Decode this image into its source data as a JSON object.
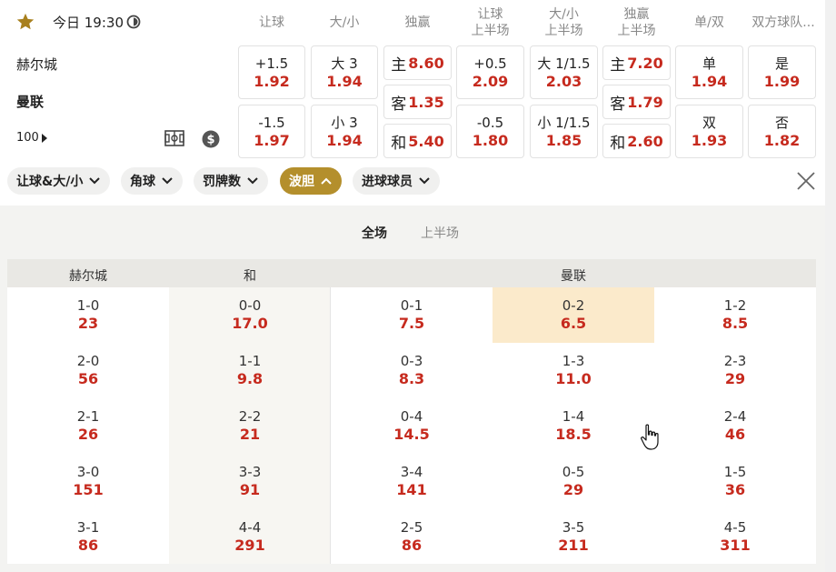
{
  "match": {
    "time": "今日 19:30",
    "home": "赫尔城",
    "away": "曼联",
    "more_markets": "100"
  },
  "columns": [
    {
      "line1": "让球",
      "line2": ""
    },
    {
      "line1": "大/小",
      "line2": ""
    },
    {
      "line1": "独赢",
      "line2": ""
    },
    {
      "line1": "让球",
      "line2": "上半场"
    },
    {
      "line1": "大/小",
      "line2": "上半场"
    },
    {
      "line1": "独赢",
      "line2": "上半场"
    },
    {
      "line1": "单/双",
      "line2": ""
    },
    {
      "line1": "双方球队...",
      "line2": ""
    }
  ],
  "odds": {
    "handicap": [
      {
        "label": "+1.5",
        "value": "1.92"
      },
      {
        "label": "-1.5",
        "value": "1.97"
      }
    ],
    "over_under": [
      {
        "label": "大 3",
        "value": "1.94"
      },
      {
        "label": "小 3",
        "value": "1.94"
      }
    ],
    "moneyline": [
      {
        "label": "主",
        "value": "8.60"
      },
      {
        "label": "客",
        "value": "1.35"
      },
      {
        "label": "和",
        "value": "5.40"
      }
    ],
    "handicap_1h": [
      {
        "label": "+0.5",
        "value": "2.09"
      },
      {
        "label": "-0.5",
        "value": "1.80"
      }
    ],
    "over_under_1h": [
      {
        "label": "大 1/1.5",
        "value": "2.03"
      },
      {
        "label": "小 1/1.5",
        "value": "1.85"
      }
    ],
    "moneyline_1h": [
      {
        "label": "主",
        "value": "7.20"
      },
      {
        "label": "客",
        "value": "1.79"
      },
      {
        "label": "和",
        "value": "2.60"
      }
    ],
    "odd_even": [
      {
        "label": "单",
        "value": "1.94"
      },
      {
        "label": "双",
        "value": "1.93"
      }
    ],
    "btts": [
      {
        "label": "是",
        "value": "1.99"
      },
      {
        "label": "否",
        "value": "1.82"
      }
    ]
  },
  "filters": [
    {
      "label": "让球&大/小",
      "active": false
    },
    {
      "label": "角球",
      "active": false
    },
    {
      "label": "罚牌数",
      "active": false
    },
    {
      "label": "波胆",
      "active": true
    },
    {
      "label": "进球球员",
      "active": false
    }
  ],
  "tabs": [
    {
      "label": "全场",
      "active": true
    },
    {
      "label": "上半场",
      "active": false
    }
  ],
  "correct_score": {
    "headers": {
      "home": "赫尔城",
      "draw": "和",
      "away": "曼联"
    },
    "columns": [
      [
        {
          "score": "1-0",
          "price": "23"
        },
        {
          "score": "2-0",
          "price": "56"
        },
        {
          "score": "2-1",
          "price": "26"
        },
        {
          "score": "3-0",
          "price": "151"
        },
        {
          "score": "3-1",
          "price": "86"
        }
      ],
      [
        {
          "score": "0-0",
          "price": "17.0"
        },
        {
          "score": "1-1",
          "price": "9.8"
        },
        {
          "score": "2-2",
          "price": "21"
        },
        {
          "score": "3-3",
          "price": "91"
        },
        {
          "score": "4-4",
          "price": "291"
        }
      ],
      [
        {
          "score": "0-1",
          "price": "7.5"
        },
        {
          "score": "0-3",
          "price": "8.3"
        },
        {
          "score": "0-4",
          "price": "14.5"
        },
        {
          "score": "3-4",
          "price": "141"
        },
        {
          "score": "2-5",
          "price": "86"
        }
      ],
      [
        {
          "score": "0-2",
          "price": "6.5"
        },
        {
          "score": "1-3",
          "price": "11.0"
        },
        {
          "score": "1-4",
          "price": "18.5"
        },
        {
          "score": "0-5",
          "price": "29"
        },
        {
          "score": "3-5",
          "price": "211"
        }
      ],
      [
        {
          "score": "1-2",
          "price": "8.5"
        },
        {
          "score": "2-3",
          "price": "29"
        },
        {
          "score": "2-4",
          "price": "46"
        },
        {
          "score": "1-5",
          "price": "36"
        },
        {
          "score": "4-5",
          "price": "311"
        }
      ]
    ],
    "highlighted": "0-2"
  },
  "colors": {
    "accent": "#b48f2c",
    "odds_red": "#c62a1e",
    "highlight": "#fbeacb"
  }
}
